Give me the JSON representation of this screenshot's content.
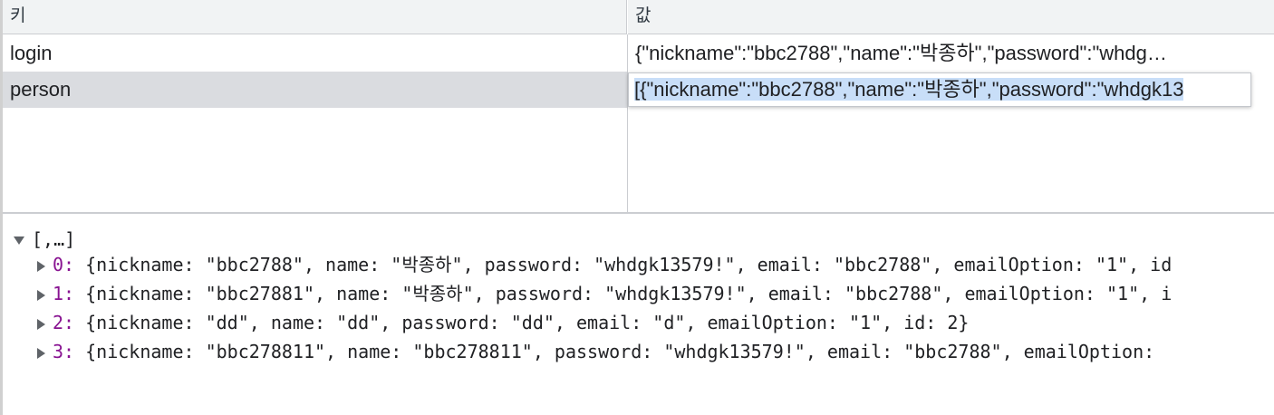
{
  "table": {
    "headers": {
      "key": "키",
      "value": "값"
    },
    "rows": [
      {
        "key": "login",
        "value": "{\"nickname\":\"bbc2788\",\"name\":\"박종하\",\"password\":\"whdg…"
      },
      {
        "key": "person",
        "value": ""
      }
    ],
    "editing": {
      "value": "[{\"nickname\":\"bbc2788\",\"name\":\"박종하\",\"password\":\"whdgk13"
    }
  },
  "preview": {
    "root_label": "[,…]",
    "items": [
      {
        "index": "0:",
        "text": "{nickname: \"bbc2788\", name: \"박종하\", password: \"whdgk13579!\", email: \"bbc2788\", emailOption: \"1\", id"
      },
      {
        "index": "1:",
        "text": "{nickname: \"bbc27881\", name: \"박종하\", password: \"whdgk13579!\", email: \"bbc2788\", emailOption: \"1\", i"
      },
      {
        "index": "2:",
        "text": "{nickname: \"dd\", name: \"dd\", password: \"dd\", email: \"d\", emailOption: \"1\", id: 2}"
      },
      {
        "index": "3:",
        "text": "{nickname: \"bbc278811\", name: \"bbc278811\", password: \"whdgk13579!\", email: \"bbc2788\", emailOption: "
      }
    ]
  }
}
